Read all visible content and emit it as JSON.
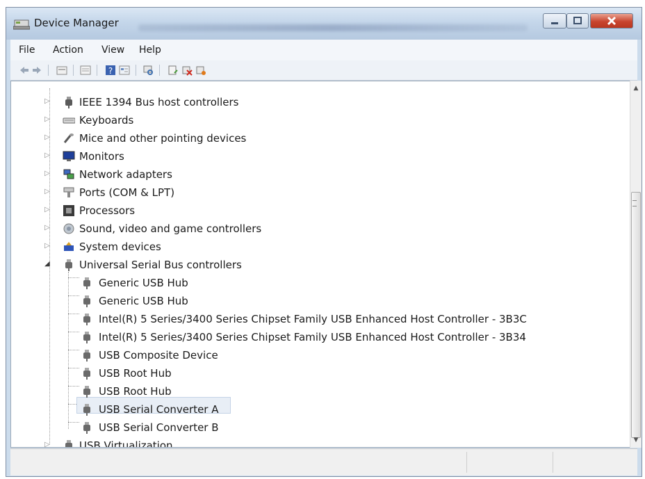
{
  "window": {
    "title": "Device Manager"
  },
  "menu": {
    "items": [
      "File",
      "Action",
      "View",
      "Help"
    ]
  },
  "toolbar": {
    "icons": [
      "back-arrow-icon",
      "forward-arrow-icon",
      "show-hidden-icon",
      "properties-grid-icon",
      "help-icon",
      "view-list-icon",
      "scan-hardware-icon",
      "update-driver-icon",
      "uninstall-icon",
      "disable-device-icon"
    ]
  },
  "tree": {
    "categories": [
      {
        "label": "IEEE 1394 Bus host controllers",
        "icon": "plug-icon"
      },
      {
        "label": "Keyboards",
        "icon": "keyboard-icon"
      },
      {
        "label": "Mice and other pointing devices",
        "icon": "mouse-icon"
      },
      {
        "label": "Monitors",
        "icon": "monitor-icon"
      },
      {
        "label": "Network adapters",
        "icon": "network-icon"
      },
      {
        "label": "Ports (COM & LPT)",
        "icon": "port-icon"
      },
      {
        "label": "Processors",
        "icon": "processor-icon"
      },
      {
        "label": "Sound, video and game controllers",
        "icon": "speaker-icon"
      },
      {
        "label": "System devices",
        "icon": "system-icon"
      },
      {
        "label": "Universal Serial Bus controllers",
        "icon": "usb-plug-icon",
        "expanded": true
      }
    ],
    "usb_children": [
      "Generic USB Hub",
      "Generic USB Hub",
      "Intel(R) 5 Series/3400 Series Chipset Family USB Enhanced Host Controller - 3B3C",
      "Intel(R) 5 Series/3400 Series Chipset Family USB Enhanced Host Controller - 3B34",
      "USB Composite Device",
      "USB Root Hub",
      "USB Root Hub",
      "USB Serial Converter A",
      "USB Serial Converter B"
    ],
    "selected_label": "USB Serial Converter A",
    "after": [
      {
        "label": "USB Virtualization",
        "icon": "usb-plug-icon"
      }
    ]
  },
  "colors": {
    "title_bar": "#c4d6ea",
    "close_button": "#c8452f",
    "selection": "#e8eef6"
  }
}
